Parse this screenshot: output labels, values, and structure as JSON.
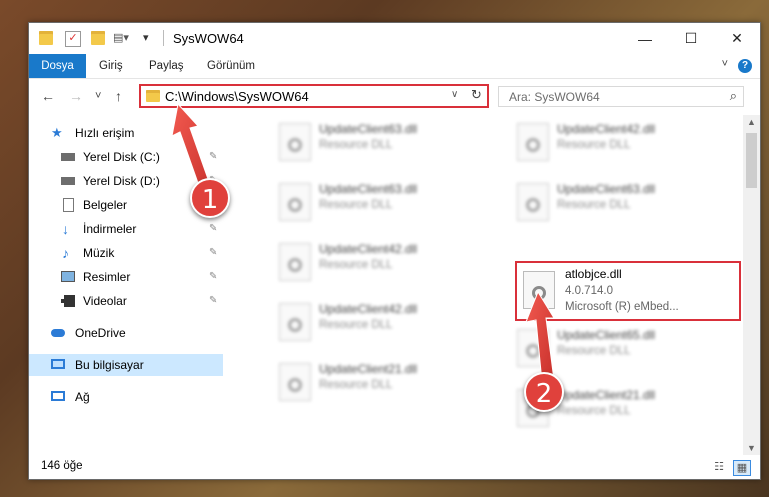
{
  "window": {
    "title": "SysWOW64",
    "min_glyph": "—",
    "max_glyph": "☐",
    "close_glyph": "✕"
  },
  "ribbon": {
    "tabs": [
      "Dosya",
      "Giriş",
      "Paylaş",
      "Görünüm"
    ],
    "help_glyph": "?",
    "collapse_glyph": "˅"
  },
  "nav": {
    "back_glyph": "←",
    "forward_glyph": "→",
    "recent_glyph": "˅",
    "up_glyph": "↑",
    "address_path": "C:\\Windows\\SysWOW64",
    "address_dropdown_glyph": "∨",
    "refresh_glyph": "↻",
    "search_placeholder": "Ara: SysWOW64",
    "search_glyph": "⌕"
  },
  "sidebar": {
    "items": [
      {
        "label": "Hızlı erişim",
        "icon": "star-icon",
        "pinned": false
      },
      {
        "label": "Yerel Disk (C:)",
        "icon": "drive-icon",
        "pinned": true
      },
      {
        "label": "Yerel Disk (D:)",
        "icon": "drive-icon",
        "pinned": true
      },
      {
        "label": "Belgeler",
        "icon": "document-icon",
        "pinned": true
      },
      {
        "label": "İndirmeler",
        "icon": "download-icon",
        "pinned": true
      },
      {
        "label": "Müzik",
        "icon": "music-icon",
        "pinned": true
      },
      {
        "label": "Resimler",
        "icon": "pictures-icon",
        "pinned": true
      },
      {
        "label": "Videolar",
        "icon": "video-icon",
        "pinned": true
      },
      {
        "label": "OneDrive",
        "icon": "cloud-icon",
        "pinned": false
      },
      {
        "label": "Bu bilgisayar",
        "icon": "computer-icon",
        "pinned": false,
        "selected": true
      },
      {
        "label": "Ağ",
        "icon": "network-icon",
        "pinned": false
      }
    ],
    "pin_glyph": "📌"
  },
  "files": {
    "tiles": [
      {
        "name": "UpdateClient63.dll",
        "desc": "Resource DLL",
        "blurred": true
      },
      {
        "name": "UpdateClient42.dll",
        "desc": "Resource DLL",
        "blurred": true
      },
      {
        "name": "UpdateClient63.dll",
        "desc": "Resource DLL",
        "blurred": true
      },
      {
        "name": "UpdateClient63.dll",
        "desc": "Resource DLL",
        "blurred": true
      },
      {
        "name": "UpdateClient42.dll",
        "desc": "Resource DLL",
        "blurred": true
      },
      {
        "name": "atlobjce.dll",
        "desc": "4.0.714.0",
        "desc2": "Microsoft (R) eMbed...",
        "blurred": false,
        "highlighted": true
      },
      {
        "name": "UpdateClient42.dll",
        "desc": "Resource DLL",
        "blurred": true
      },
      {
        "name": "UpdateClient65.dll",
        "desc": "Resource DLL",
        "blurred": true
      },
      {
        "name": "UpdateClient21.dll",
        "desc": "Resource DLL",
        "blurred": true
      },
      {
        "name": "UpdateClient21.dll",
        "desc": "Resource DLL",
        "blurred": true
      }
    ]
  },
  "status": {
    "count": "146 öğe"
  },
  "annotations": {
    "badge1": "1",
    "badge2": "2",
    "color": "#e0413c"
  }
}
